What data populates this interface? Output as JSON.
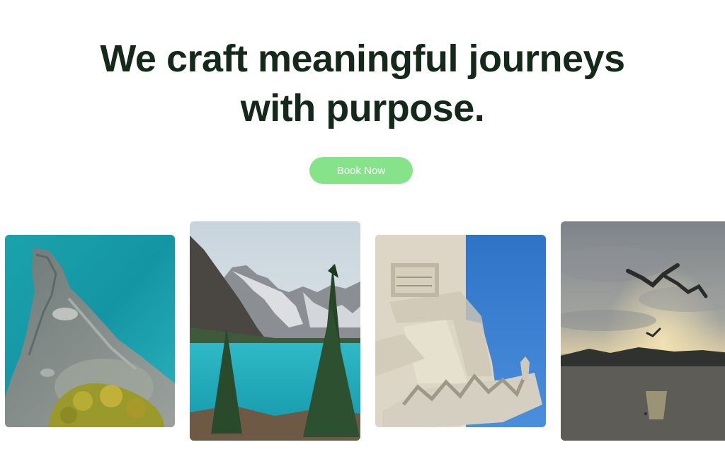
{
  "hero": {
    "title_line1": "We craft meaningful journeys",
    "title_line2": "with purpose."
  },
  "cta": {
    "label": "Book Now",
    "color": "#86e38a"
  },
  "gallery": {
    "images": [
      {
        "subject": "aerial-coastline-photo"
      },
      {
        "subject": "mountain-lake-photo"
      },
      {
        "subject": "monument-sculpture-photo"
      },
      {
        "subject": "sunset-birds-lake-photo"
      }
    ]
  },
  "colors": {
    "title": "#14291a",
    "background": "#ffffff"
  }
}
